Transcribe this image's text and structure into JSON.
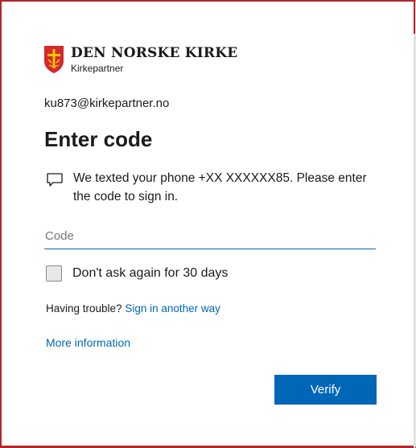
{
  "brand": {
    "name": "DEN NORSKE KIRKE",
    "subtitle": "Kirkepartner",
    "crest_color": "#d42a2e",
    "crest_accent": "#f5c400"
  },
  "account": {
    "email": "ku873@kirkepartner.no"
  },
  "page": {
    "title": "Enter code",
    "message": "We texted your phone +XX XXXXXX85. Please enter the code to sign in.",
    "message_icon": "chat-bubble-icon"
  },
  "code_field": {
    "placeholder": "Code",
    "value": ""
  },
  "remember": {
    "label": "Don't ask again for 30 days",
    "checked": false
  },
  "help": {
    "prefix": "Having trouble?",
    "link_text": "Sign in another way",
    "more_info": "More information"
  },
  "actions": {
    "verify_label": "Verify"
  },
  "colors": {
    "accent": "#0067b8",
    "border": "#b0282c"
  }
}
